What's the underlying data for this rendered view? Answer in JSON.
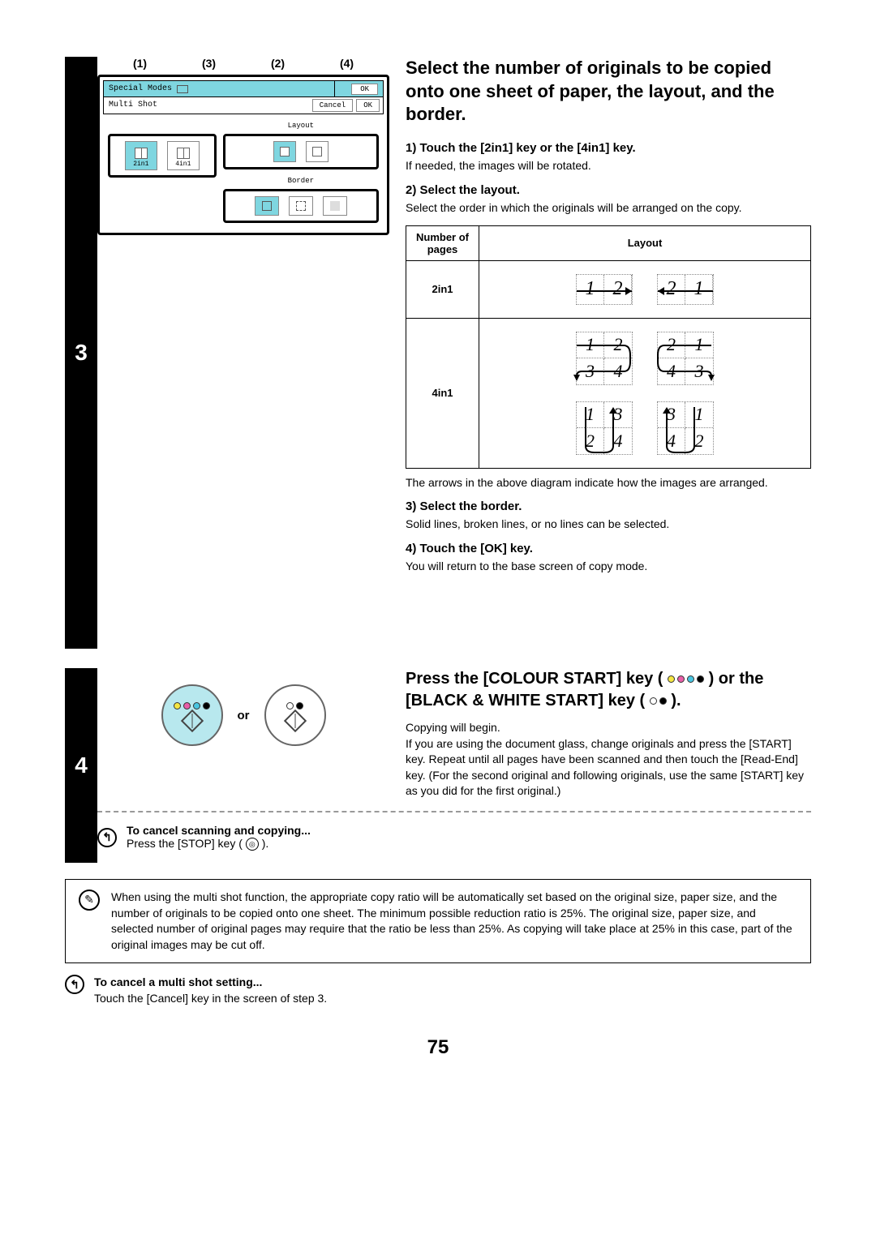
{
  "step3": {
    "number": "3",
    "callouts": [
      "(1)",
      "(3)",
      "(2)",
      "(4)"
    ],
    "lcd": {
      "special_modes": "Special Modes",
      "multi_shot": "Multi Shot",
      "ok": "OK",
      "cancel": "Cancel",
      "layout": "Layout",
      "border": "Border",
      "k2in1": "2in1",
      "k4in1": "4in1"
    },
    "heading": "Select the number of originals to be copied onto one sheet of paper, the layout, and the border.",
    "s1_head": "1)  Touch the [2in1] key or the [4in1] key.",
    "s1_body": "If needed, the images will be rotated.",
    "s2_head": "2)  Select the layout.",
    "s2_body": "Select the order in which the originals will be arranged on the copy.",
    "table": {
      "col_pages": "Number of pages",
      "col_layout": "Layout",
      "row_2in1": "2in1",
      "row_4in1": "4in1"
    },
    "caption_arrows": "The arrows in the above diagram indicate how the images are arranged.",
    "s3_head": "3)  Select the border.",
    "s3_body": "Solid lines, broken lines, or no lines can be selected.",
    "s4_head": "4)  Touch the [OK] key.",
    "s4_body": "You will return to the base screen of copy mode."
  },
  "step4": {
    "number": "4",
    "or": "or",
    "heading_a": "Press the [COLOUR START] key (",
    "heading_b": ") or the [BLACK & WHITE START] key (",
    "heading_c": ").",
    "body1": "Copying will begin.",
    "body2": "If you are using the document glass, change originals and press the [START] key. Repeat until all pages have been scanned and then touch the [Read-End] key. (For the second original and following originals, use the same [START] key as you did for the first original.)",
    "cancel_head": "To cancel scanning and copying...",
    "cancel_body_a": "Press the [STOP] key (",
    "cancel_body_b": ")."
  },
  "note": "When using the multi shot function, the appropriate copy ratio will be automatically set based on the original size, paper size, and the number of originals to be copied onto one sheet. The minimum possible reduction ratio is 25%. The original size, paper size, and selected number of original pages may require that the ratio be less than 25%. As copying will take place at 25% in this case, part of the original images may be cut off.",
  "bottom_cancel": {
    "head": "To cancel a multi shot setting...",
    "body": "Touch the [Cancel] key in the screen of step 3."
  },
  "page_number": "75"
}
